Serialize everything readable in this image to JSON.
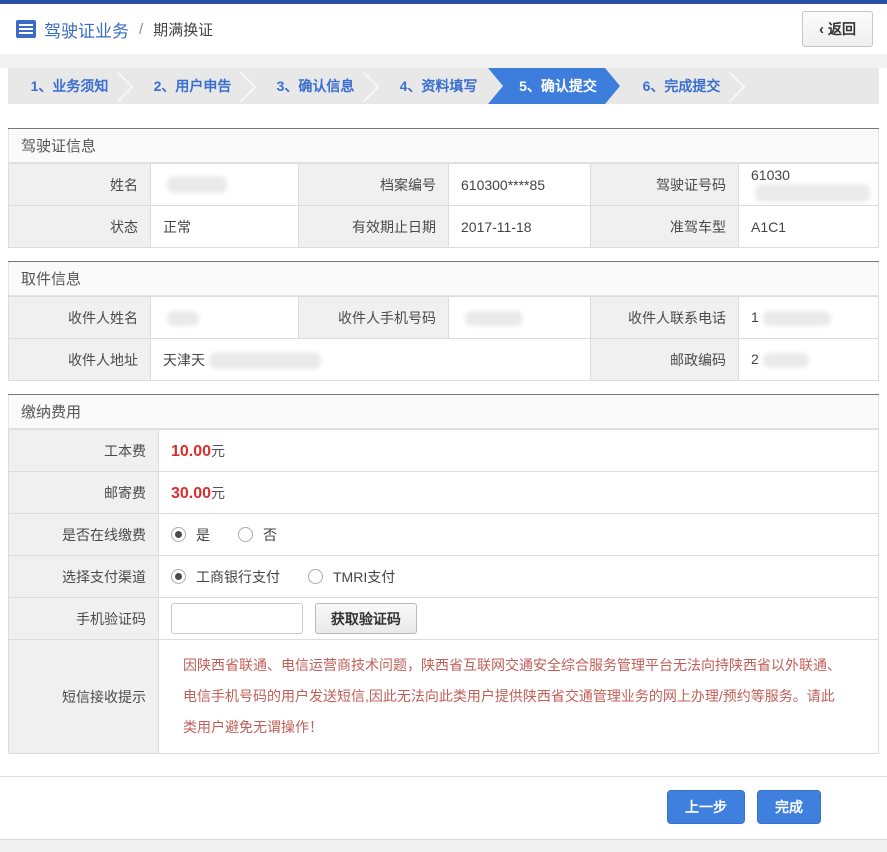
{
  "header": {
    "title": "驾驶证业务",
    "separator": "/",
    "subtitle": "期满换证",
    "back_chevron": "‹",
    "back_button": "返回"
  },
  "steps": {
    "items": [
      {
        "label": "1、业务须知",
        "active": false
      },
      {
        "label": "2、用户申告",
        "active": false
      },
      {
        "label": "3、确认信息",
        "active": false
      },
      {
        "label": "4、资料填写",
        "active": false
      },
      {
        "label": "5、确认提交",
        "active": true
      },
      {
        "label": "6、完成提交",
        "active": false
      }
    ]
  },
  "license_info": {
    "section_title": "驾驶证信息",
    "name_label": "姓名",
    "name_value": "",
    "file_number_label": "档案编号",
    "file_number_value": "610300****85",
    "license_number_label": "驾驶证号码",
    "license_number_value": "61030",
    "status_label": "状态",
    "status_value": "正常",
    "expiry_label": "有效期止日期",
    "expiry_value": "2017-11-18",
    "vehicle_type_label": "准驾车型",
    "vehicle_type_value": "A1C1"
  },
  "pickup_info": {
    "section_title": "取件信息",
    "recipient_name_label": "收件人姓名",
    "recipient_name_value": "",
    "recipient_mobile_label": "收件人手机号码",
    "recipient_mobile_value": "",
    "recipient_phone_label": "收件人联系电话",
    "recipient_phone_value": "1",
    "address_label": "收件人地址",
    "address_value": "天津天",
    "postcode_label": "邮政编码",
    "postcode_value": "2"
  },
  "payment": {
    "section_title": "缴纳费用",
    "production_fee_label": "工本费",
    "production_fee_value": "10.00",
    "mailing_fee_label": "邮寄费",
    "mailing_fee_value": "30.00",
    "fee_unit": "元",
    "online_payment_label": "是否在线缴费",
    "online_yes_label": "是",
    "online_no_label": "否",
    "online_selected": "是",
    "channel_label": "选择支付渠道",
    "channel_icbc_label": "工商银行支付",
    "channel_tmri_label": "TMRI支付",
    "channel_selected": "工商银行支付",
    "sms_code_label": "手机验证码",
    "sms_code_value": "",
    "get_code_button": "获取验证码",
    "sms_notice_label": "短信接收提示",
    "sms_notice_text": "因陕西省联通、电信运营商技术问题，陕西省互联网交通安全综合服务管理平台无法向持陕西省以外联通、电信手机号码的用户发送短信,因此无法向此类用户提供陕西省交通管理业务的网上办理/预约等服务。请此类用户避免无谓操作！"
  },
  "footer": {
    "prev_button": "上一步",
    "finish_button": "完成"
  },
  "colors": {
    "accent_blue": "#3d7edc",
    "top_bar_blue": "#2b50a5",
    "fee_red": "#d9302e",
    "notice_red": "#c05f58"
  }
}
